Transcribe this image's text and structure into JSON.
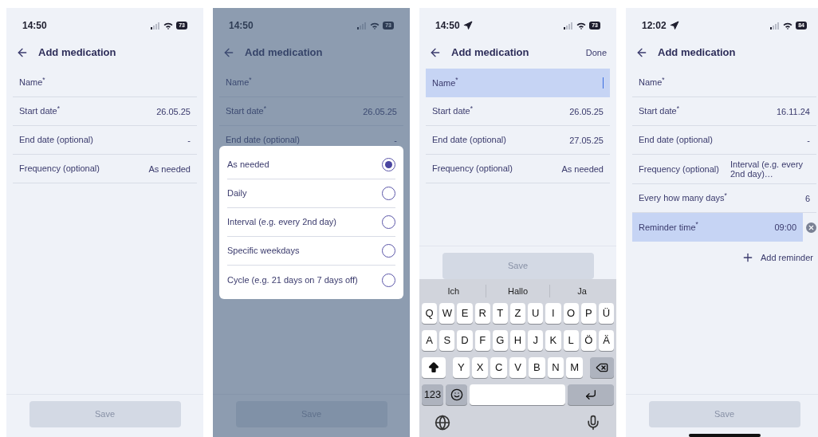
{
  "screens": [
    {
      "time": "14:50",
      "location": false,
      "battery": "73",
      "title": "Add medication",
      "fields": [
        {
          "label": "Name$^{*}$",
          "focused": false
        },
        {
          "label": "Start date$^{*}$",
          "value": "26.05.25",
          "focused": false
        },
        {
          "label": "End date (optional)",
          "value": "-",
          "focused": false
        },
        {
          "label": "Frequency (optional)",
          "value": "As needed",
          "focused": false
        }
      ],
      "save": "Save"
    },
    {
      "time": "14:50",
      "location": false,
      "battery": "73",
      "title": "Add medication",
      "fields": [
        {
          "label": "Name$^{*}$",
          "focused": false
        },
        {
          "label": "Start date$^{*}$",
          "value": "26.05.25",
          "focused": false
        },
        {
          "label": "End date (optional)",
          "value": "-",
          "focused": false
        }
      ],
      "save": "Save",
      "sheet": {
        "options": [
          {
            "label": "As needed",
            "selected": true
          },
          {
            "label": "Daily",
            "selected": false
          },
          {
            "label": "Interval (e.g. every 2nd day)",
            "selected": false
          },
          {
            "label": "Specific weekdays",
            "selected": false
          },
          {
            "label": "Cycle (e.g. 21 days on 7 days off)",
            "selected": false
          }
        ]
      }
    },
    {
      "time": "14:50",
      "location": true,
      "battery": "73",
      "title": "Add medication",
      "done": "Done",
      "fields": [
        {
          "label": "Name$^{*}$",
          "focused": true,
          "cursor": true
        },
        {
          "label": "Start date$^{*}$",
          "value": "26.05.25",
          "focused": false
        },
        {
          "label": "End date (optional)",
          "value": "27.05.25",
          "focused": false
        },
        {
          "label": "Frequency (optional)",
          "value": "As needed",
          "focused": false
        }
      ],
      "save": "Save",
      "keyboard": {
        "suggestions": [
          "Ich",
          "Hallo",
          "Ja"
        ],
        "rows": [
          {
            "kind": "letters",
            "keys": [
              "Q",
              "W",
              "E",
              "R",
              "T",
              "Z",
              "U",
              "I",
              "O",
              "P",
              "Ü"
            ]
          },
          {
            "kind": "letters",
            "keys": [
              "A",
              "S",
              "D",
              "F",
              "G",
              "H",
              "J",
              "K",
              "L",
              "Ö",
              "Ä"
            ]
          },
          {
            "kind": "shift_row",
            "keys": [
              "Y",
              "X",
              "C",
              "V",
              "B",
              "N",
              "M"
            ]
          },
          {
            "kind": "space_row",
            "mode_key": "123"
          }
        ]
      }
    },
    {
      "time": "12:02",
      "location": true,
      "battery": "84",
      "title": "Add medication",
      "fields": [
        {
          "label": "Name$^{*}$",
          "focused": false
        },
        {
          "label": "Start date$^{*}$",
          "value": "16.11.24",
          "focused": false
        },
        {
          "label": "End date (optional)",
          "value": "-",
          "focused": false
        },
        {
          "label": "Frequency (optional)",
          "value": "Interval (e.g. every 2nd day)…",
          "focused": false
        },
        {
          "label": "Every how many days$^{*}$",
          "value": "6",
          "focused": false
        },
        {
          "label": "Reminder time$^{*}$",
          "value": "09:00",
          "focused": true,
          "removable": true
        }
      ],
      "add_reminder": "Add reminder",
      "save": "Save",
      "home_indicator": true
    }
  ]
}
